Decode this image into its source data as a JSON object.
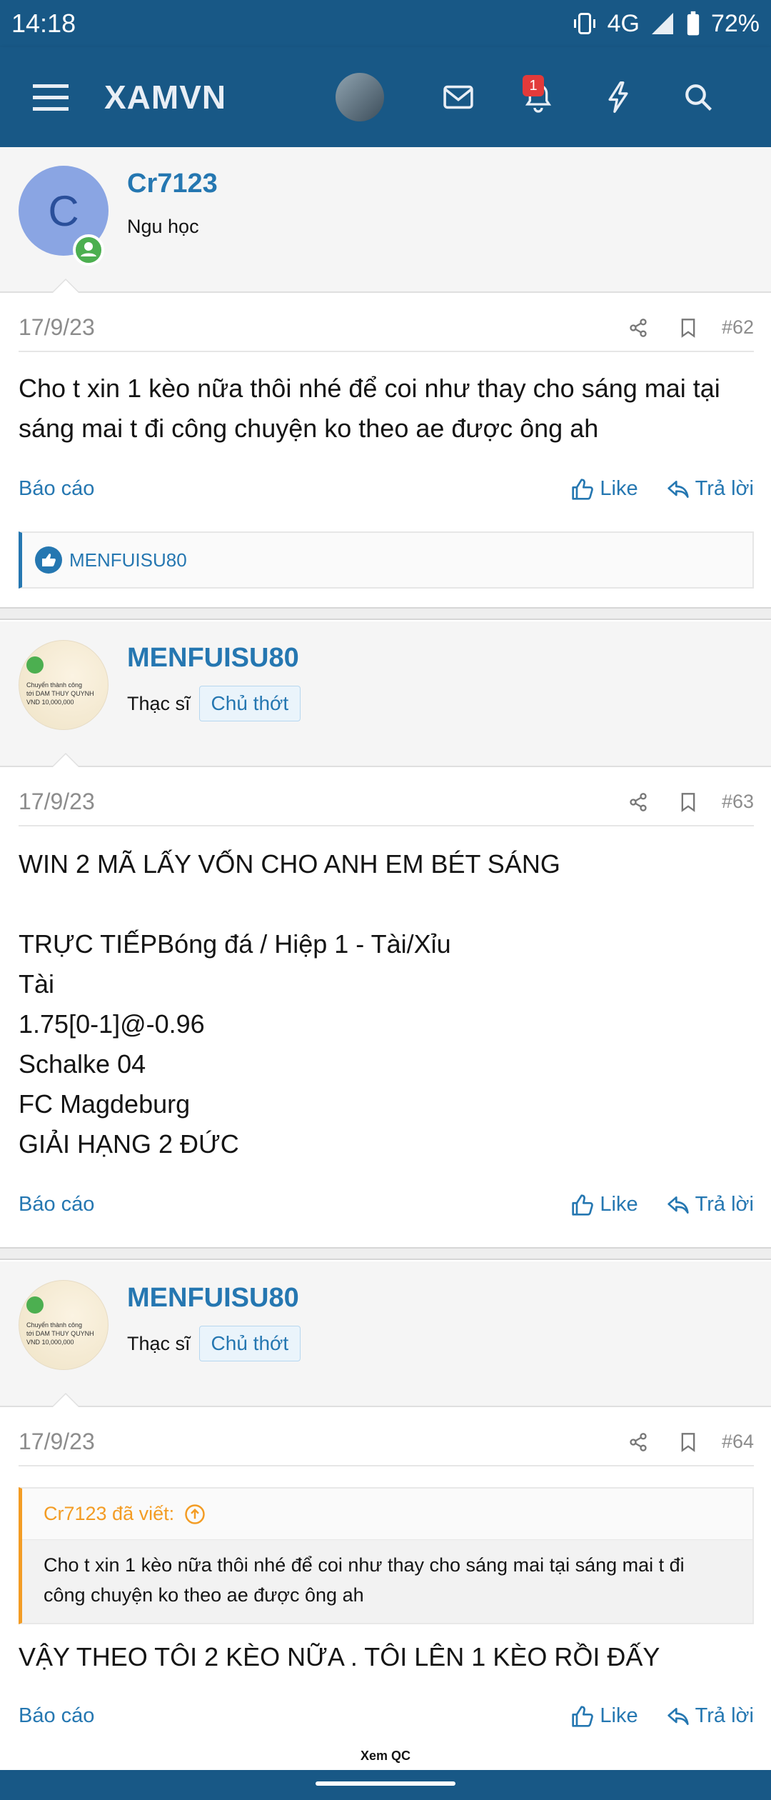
{
  "status_bar": {
    "time": "14:18",
    "network": "4G",
    "battery": "72%"
  },
  "app": {
    "title": "XAMVN",
    "notification_count": "1"
  },
  "posts": [
    {
      "user": {
        "name": "Cr7123",
        "title": "Ngu học",
        "avatar_letter": "C"
      },
      "date": "17/9/23",
      "number": "#62",
      "body": "Cho t xin 1 kèo nữa thôi nhé để coi như thay cho sáng mai tại sáng mai t đi công chuyện ko theo ae được ông ah",
      "report_label": "Báo cáo",
      "like_label": "Like",
      "reply_label": "Trả lời",
      "reactions": "MENFUISU80"
    },
    {
      "user": {
        "name": "MENFUISU80",
        "title": "Thạc sĩ",
        "badge": "Chủ thớt"
      },
      "avatar_text": [
        "Chuyển thành công",
        "tới DAM THUY QUYNH",
        "VND 10,000,000"
      ],
      "date": "17/9/23",
      "number": "#63",
      "body": "WIN 2 MÃ LẤY VỐN CHO ANH EM BÉT SÁNG\n\nTRỰC TIẾPBóng đá / Hiệp 1 - Tài/Xỉu\nTài\n1.75[0-1]@-0.96\nSchalke 04\nFC Magdeburg\nGIẢI HẠNG 2 ĐỨC",
      "report_label": "Báo cáo",
      "like_label": "Like",
      "reply_label": "Trả lời"
    },
    {
      "user": {
        "name": "MENFUISU80",
        "title": "Thạc sĩ",
        "badge": "Chủ thớt"
      },
      "avatar_text": [
        "Chuyển thành công",
        "tới DAM THUY QUYNH",
        "VND 10,000,000"
      ],
      "date": "17/9/23",
      "number": "#64",
      "quote": {
        "header": "Cr7123 đã viết:",
        "text": "Cho t xin 1 kèo nữa thôi nhé để coi như thay cho sáng mai tại sáng mai t đi công chuyện ko theo ae được ông ah"
      },
      "body": "VẬY THEO TÔI 2 KÈO NỮA . TÔI LÊN 1 KÈO RỒI ĐẤY",
      "report_label": "Báo cáo",
      "like_label": "Like",
      "reply_label": "Trả lời"
    }
  ],
  "ad_label": "Xem QC",
  "colors": {
    "primary": "#185886",
    "link": "#2577b1",
    "quote_accent": "#f39c24",
    "badge": "#e23a3a"
  }
}
